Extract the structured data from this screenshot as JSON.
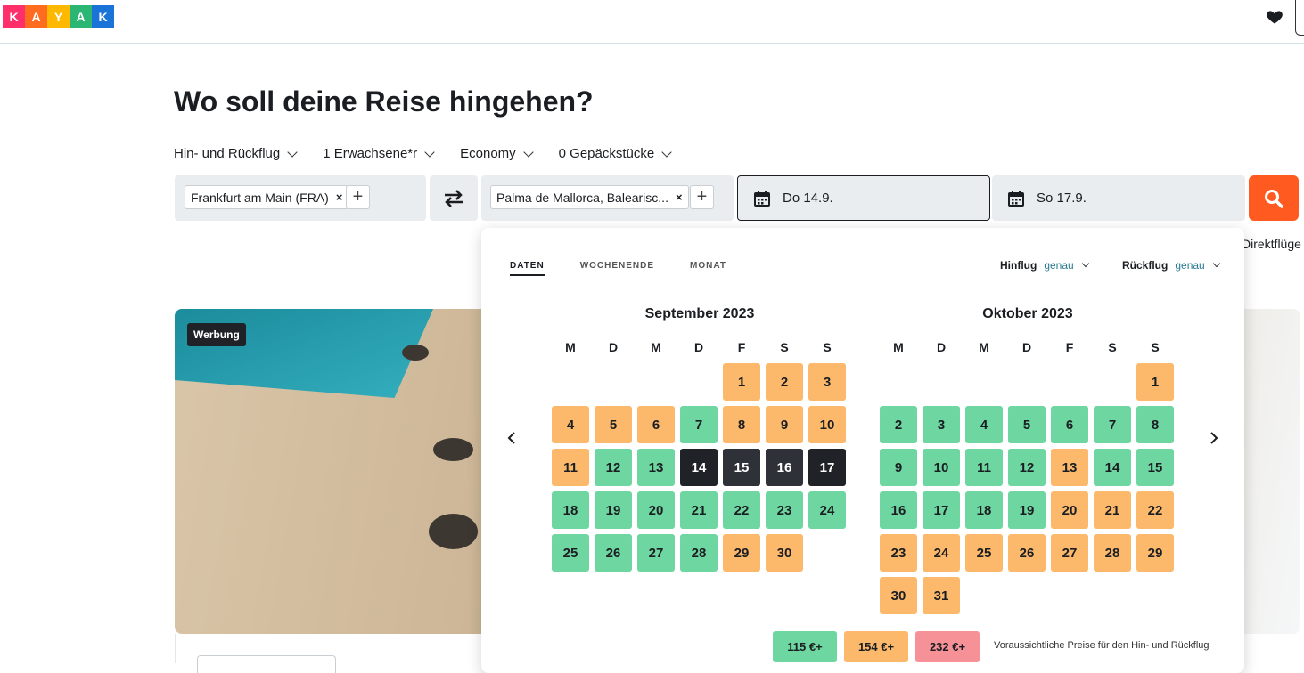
{
  "header": {
    "logo_letters": [
      "K",
      "A",
      "Y",
      "A",
      "K"
    ],
    "logo_colors": [
      "#ff2f6b",
      "#ff6b1f",
      "#ffb800",
      "#2bb673",
      "#1a74d8"
    ],
    "favorites_icon": "heart-icon"
  },
  "main": {
    "title": "Wo soll deine Reise hingehen?",
    "options": {
      "trip_type": "Hin- und Rückflug",
      "passengers": "1 Erwachsene*r",
      "cabin": "Economy",
      "bags": "0 Gepäckstücke"
    },
    "origin": {
      "value": "Frankfurt am Main (FRA)",
      "remove": "×",
      "add": "+"
    },
    "destination": {
      "value": "Palma de Mallorca, Balearisc...",
      "remove": "×",
      "add": "+"
    },
    "depart_date": "Do 14.9.",
    "return_date": "So 17.9.",
    "direct_flights": "Direktflüge",
    "accent_color": "#ff5a1f"
  },
  "ad": {
    "badge": "Werbung"
  },
  "picker": {
    "tabs": [
      "DATEN",
      "WOCHENENDE",
      "MONAT"
    ],
    "outbound": {
      "label": "Hinflug",
      "value": "genau"
    },
    "inbound": {
      "label": "Rückflug",
      "value": "genau"
    },
    "weekdays": [
      "M",
      "D",
      "M",
      "D",
      "F",
      "S",
      "S"
    ],
    "months": [
      {
        "title": "September 2023",
        "offset": 4,
        "days": [
          {
            "d": "1",
            "s": "o"
          },
          {
            "d": "2",
            "s": "o"
          },
          {
            "d": "3",
            "s": "o"
          },
          {
            "d": "4",
            "s": "o"
          },
          {
            "d": "5",
            "s": "o"
          },
          {
            "d": "6",
            "s": "o"
          },
          {
            "d": "7",
            "s": "g"
          },
          {
            "d": "8",
            "s": "o"
          },
          {
            "d": "9",
            "s": "o"
          },
          {
            "d": "10",
            "s": "o"
          },
          {
            "d": "11",
            "s": "o"
          },
          {
            "d": "12",
            "s": "g"
          },
          {
            "d": "13",
            "s": "g"
          },
          {
            "d": "14",
            "s": "sel"
          },
          {
            "d": "15",
            "s": "range"
          },
          {
            "d": "16",
            "s": "range"
          },
          {
            "d": "17",
            "s": "sel"
          },
          {
            "d": "18",
            "s": "g"
          },
          {
            "d": "19",
            "s": "g"
          },
          {
            "d": "20",
            "s": "g"
          },
          {
            "d": "21",
            "s": "g"
          },
          {
            "d": "22",
            "s": "g"
          },
          {
            "d": "23",
            "s": "g"
          },
          {
            "d": "24",
            "s": "g"
          },
          {
            "d": "25",
            "s": "g"
          },
          {
            "d": "26",
            "s": "g"
          },
          {
            "d": "27",
            "s": "g"
          },
          {
            "d": "28",
            "s": "g"
          },
          {
            "d": "29",
            "s": "o"
          },
          {
            "d": "30",
            "s": "o"
          }
        ]
      },
      {
        "title": "Oktober 2023",
        "offset": 6,
        "days": [
          {
            "d": "1",
            "s": "o"
          },
          {
            "d": "2",
            "s": "g"
          },
          {
            "d": "3",
            "s": "g"
          },
          {
            "d": "4",
            "s": "g"
          },
          {
            "d": "5",
            "s": "g"
          },
          {
            "d": "6",
            "s": "g"
          },
          {
            "d": "7",
            "s": "g"
          },
          {
            "d": "8",
            "s": "g"
          },
          {
            "d": "9",
            "s": "g"
          },
          {
            "d": "10",
            "s": "g"
          },
          {
            "d": "11",
            "s": "g"
          },
          {
            "d": "12",
            "s": "g"
          },
          {
            "d": "13",
            "s": "o"
          },
          {
            "d": "14",
            "s": "g"
          },
          {
            "d": "15",
            "s": "g"
          },
          {
            "d": "16",
            "s": "g"
          },
          {
            "d": "17",
            "s": "g"
          },
          {
            "d": "18",
            "s": "g"
          },
          {
            "d": "19",
            "s": "g"
          },
          {
            "d": "20",
            "s": "o"
          },
          {
            "d": "21",
            "s": "o"
          },
          {
            "d": "22",
            "s": "o"
          },
          {
            "d": "23",
            "s": "o"
          },
          {
            "d": "24",
            "s": "o"
          },
          {
            "d": "25",
            "s": "o"
          },
          {
            "d": "26",
            "s": "o"
          },
          {
            "d": "27",
            "s": "o"
          },
          {
            "d": "28",
            "s": "o"
          },
          {
            "d": "29",
            "s": "o"
          },
          {
            "d": "30",
            "s": "o"
          },
          {
            "d": "31",
            "s": "o"
          }
        ]
      }
    ],
    "legend": [
      {
        "label": "115 €+",
        "color": "#6ed6a0"
      },
      {
        "label": "154 €+",
        "color": "#fdb96b"
      },
      {
        "label": "232 €+",
        "color": "#f79198"
      }
    ],
    "legend_note": "Voraussichtliche Preise für den Hin- und Rückflug"
  }
}
